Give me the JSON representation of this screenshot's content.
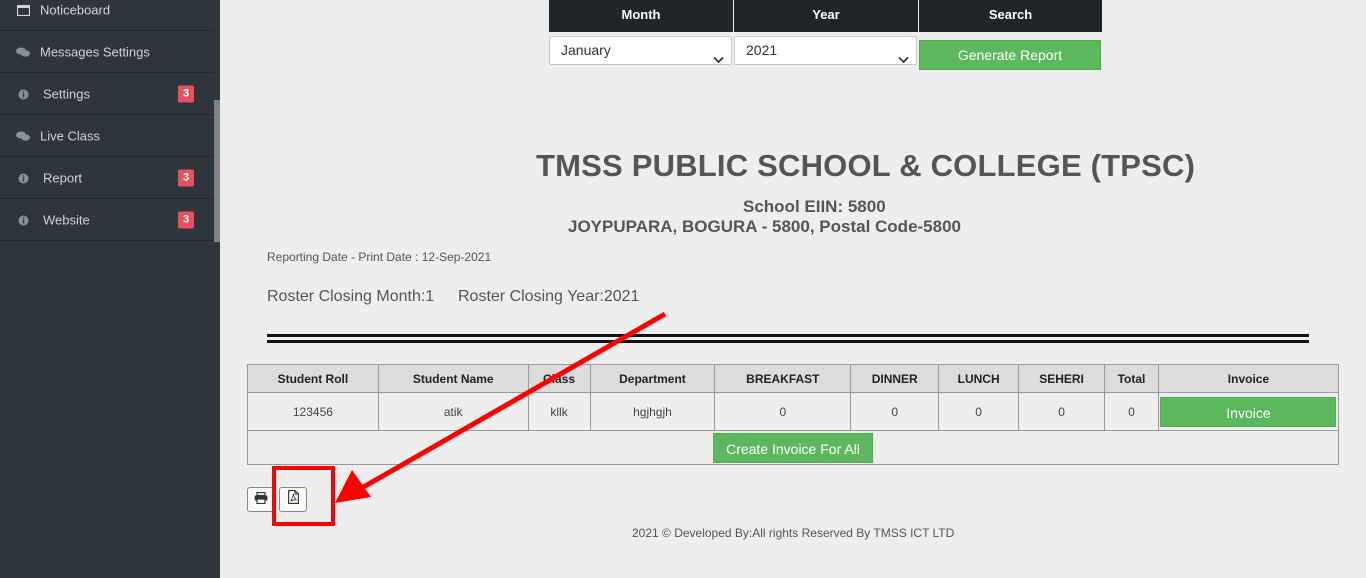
{
  "sidebar": {
    "items": [
      {
        "label": "Noticeboard",
        "icon": "window-icon",
        "badge": null
      },
      {
        "label": "Messages Settings",
        "icon": "comments-icon",
        "badge": null
      },
      {
        "label": "Settings",
        "icon": "info-icon",
        "badge": "3"
      },
      {
        "label": "Live Class",
        "icon": "comments-icon",
        "badge": null
      },
      {
        "label": "Report",
        "icon": "info-icon",
        "badge": "3"
      },
      {
        "label": "Website",
        "icon": "info-icon",
        "badge": "3"
      }
    ]
  },
  "filter": {
    "month_header": "Month",
    "year_header": "Year",
    "search_header": "Search",
    "month_value": "January",
    "year_value": "2021",
    "generate_label": "Generate Report"
  },
  "report": {
    "school_title": "TMSS PUBLIC SCHOOL & COLLEGE (TPSC)",
    "eiin": "School EIIN: 5800",
    "address": "JOYPUPARA, BOGURA - 5800, Postal Code-5800",
    "reporting_date": "Reporting Date - Print Date : 12-Sep-2021",
    "roster_month": "Roster Closing Month:1",
    "roster_year": "Roster Closing Year:2021"
  },
  "table": {
    "headers": [
      "Student Roll",
      "Student Name",
      "Class",
      "Department",
      "BREAKFAST",
      "DINNER",
      "LUNCH",
      "SEHERI",
      "Total",
      "Invoice"
    ],
    "rows": [
      {
        "roll": "123456",
        "name": "atik",
        "class": "kllk",
        "department": "hgjhgjh",
        "breakfast": "0",
        "dinner": "0",
        "lunch": "0",
        "seheri": "0",
        "total": "0",
        "invoice_label": "Invoice"
      }
    ],
    "create_all_label": "Create Invoice For All"
  },
  "export": {
    "print_icon": "print-icon",
    "pdf_icon": "pdf-file-icon"
  },
  "footer": {
    "text": "2021 © Developed By:All rights Reserved By TMSS ICT LTD"
  },
  "colors": {
    "sidebar_bg": "#2f353d",
    "header_dark": "#212529",
    "accent_green": "#5cb85c",
    "badge_red": "#e8505b",
    "annotation_red": "#ff0000"
  }
}
